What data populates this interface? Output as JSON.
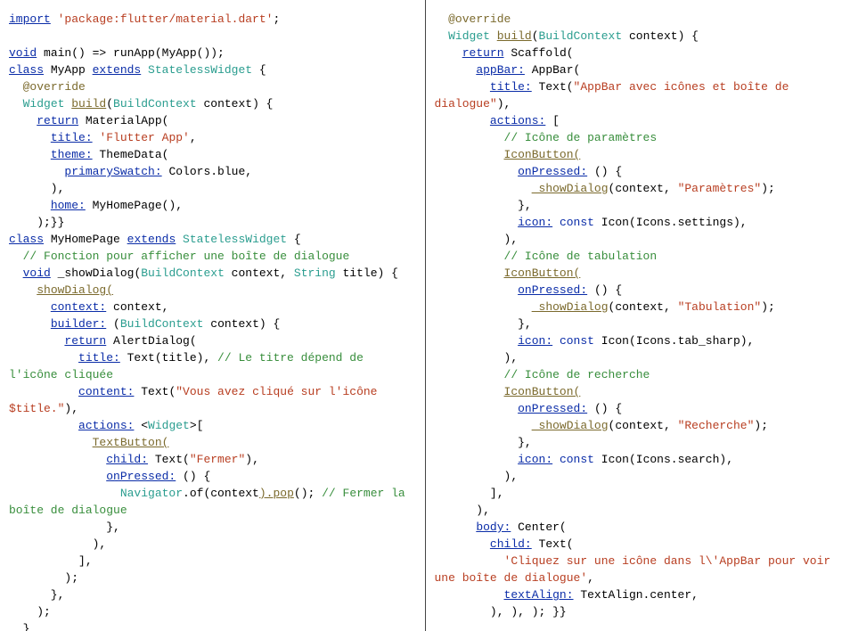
{
  "left": {
    "l01a": "import",
    "l01b": " ",
    "l01c": "'package:flutter/material.dart'",
    "l01d": ";",
    "l02": "",
    "l03a": "void",
    "l03b": " main() => runApp(MyApp());",
    "l04a": "class",
    "l04b": " MyApp ",
    "l04c": "extends",
    "l04d": " StatelessWidget",
    "l04e": " {",
    "l05a": "  ",
    "l05b": "@override",
    "l06a": "  ",
    "l06b": "Widget ",
    "l06c": "build",
    "l06d": "(",
    "l06e": "BuildContext",
    "l06f": " context) {",
    "l07a": "    ",
    "l07b": "return",
    "l07c": " MaterialApp(",
    "l08a": "      ",
    "l08b": "title:",
    "l08c": " ",
    "l08d": "'Flutter App'",
    "l08e": ",",
    "l09a": "      ",
    "l09b": "theme:",
    "l09c": " ThemeData(",
    "l10a": "        ",
    "l10b": "primarySwatch:",
    "l10c": " Colors.blue,",
    "l11": "      ),",
    "l12a": "      ",
    "l12b": "home:",
    "l12c": " MyHomePage(),",
    "l13": "    );}}",
    "l14a": "class",
    "l14b": " MyHomePage ",
    "l14c": "extends",
    "l14d": " StatelessWidget",
    "l14e": " {",
    "l15a": "  ",
    "l15b": "// Fonction pour afficher une boîte de dialogue",
    "l16a": "  ",
    "l16b": "void",
    "l16c": " _showDialog(",
    "l16d": "BuildContext",
    "l16e": " context, ",
    "l16f": "String",
    "l16g": " title) {",
    "l17a": "    ",
    "l17b": "showDialog(",
    "l18a": "      ",
    "l18b": "context:",
    "l18c": " context,",
    "l19a": "      ",
    "l19b": "builder:",
    "l19c": " (",
    "l19d": "BuildContext",
    "l19e": " context) {",
    "l20a": "        ",
    "l20b": "return",
    "l20c": " AlertDialog(",
    "l21a": "          ",
    "l21b": "title:",
    "l21c": " Text(title), ",
    "l21d": "// Le titre dépend de",
    "l22": "l'icône cliquée",
    "l23a": "          ",
    "l23b": "content:",
    "l23c": " Text(",
    "l23d": "\"Vous avez cliqué sur l'icône",
    "l24a": "$title.\"",
    "l24b": "),",
    "l25a": "          ",
    "l25b": "actions:",
    "l25c": " <",
    "l25d": "Widget",
    "l25e": ">[",
    "l26a": "            ",
    "l26b": "TextButton(",
    "l27a": "              ",
    "l27b": "child:",
    "l27c": " Text(",
    "l27d": "\"Fermer\"",
    "l27e": "),",
    "l28a": "              ",
    "l28b": "onPressed:",
    "l28c": " () {",
    "l29a": "                ",
    "l29b": "Navigator",
    "l29c": ".of(context",
    "l29d": ").pop",
    "l29e": "(); ",
    "l29f": "// Fermer la",
    "l30": "boîte de dialogue",
    "l31": "              },",
    "l32": "            ),",
    "l33": "          ],",
    "l34": "        );",
    "l35": "      },",
    "l36": "    );",
    "l37": "  }"
  },
  "right": {
    "r01a": "  ",
    "r01b": "@override",
    "r02a": "  ",
    "r02b": "Widget ",
    "r02c": "build",
    "r02d": "(",
    "r02e": "BuildContext",
    "r02f": " context) {",
    "r03a": "    ",
    "r03b": "return",
    "r03c": " Scaffold(",
    "r04a": "      ",
    "r04b": "appBar:",
    "r04c": " AppBar(",
    "r05a": "        ",
    "r05b": "title:",
    "r05c": " Text(",
    "r05d": "\"AppBar avec icônes et boîte de",
    "r06a": "dialogue\"",
    "r06b": "),",
    "r07a": "        ",
    "r07b": "actions:",
    "r07c": " [",
    "r08a": "          ",
    "r08b": "// Icône de paramètres",
    "r09a": "          ",
    "r09b": "IconButton(",
    "r10a": "            ",
    "r10b": "onPressed:",
    "r10c": " () {",
    "r11a": "              ",
    "r11b": "_showDialog",
    "r11c": "(context, ",
    "r11d": "\"Paramètres\"",
    "r11e": ");",
    "r12": "            },",
    "r13a": "            ",
    "r13b": "icon:",
    "r13c": " ",
    "r13d": "const",
    "r13e": " Icon(Icons.settings),",
    "r14": "          ),",
    "r15a": "          ",
    "r15b": "// Icône de tabulation",
    "r16a": "          ",
    "r16b": "IconButton(",
    "r17a": "            ",
    "r17b": "onPressed:",
    "r17c": " () {",
    "r18a": "              ",
    "r18b": "_showDialog",
    "r18c": "(context, ",
    "r18d": "\"Tabulation\"",
    "r18e": ");",
    "r19": "            },",
    "r20a": "            ",
    "r20b": "icon:",
    "r20c": " ",
    "r20d": "const",
    "r20e": " Icon(Icons.tab_sharp),",
    "r21": "          ),",
    "r22a": "          ",
    "r22b": "// Icône de recherche",
    "r23a": "          ",
    "r23b": "IconButton(",
    "r24a": "            ",
    "r24b": "onPressed:",
    "r24c": " () {",
    "r25a": "              ",
    "r25b": "_showDialog",
    "r25c": "(context, ",
    "r25d": "\"Recherche\"",
    "r25e": ");",
    "r26": "            },",
    "r27a": "            ",
    "r27b": "icon:",
    "r27c": " ",
    "r27d": "const",
    "r27e": " Icon(Icons.search),",
    "r28": "          ),",
    "r29": "        ],",
    "r30": "      ),",
    "r31a": "      ",
    "r31b": "body:",
    "r31c": " Center(",
    "r32a": "        ",
    "r32b": "child:",
    "r32c": " Text(",
    "r33a": "          ",
    "r33b": "'Cliquez sur une icône dans l\\'AppBar pour voir",
    "r34a": "une boîte de dialogue'",
    "r34b": ",",
    "r35a": "          ",
    "r35b": "textAlign:",
    "r35c": " TextAlign.center,",
    "r36": "        ), ), ); }}"
  }
}
